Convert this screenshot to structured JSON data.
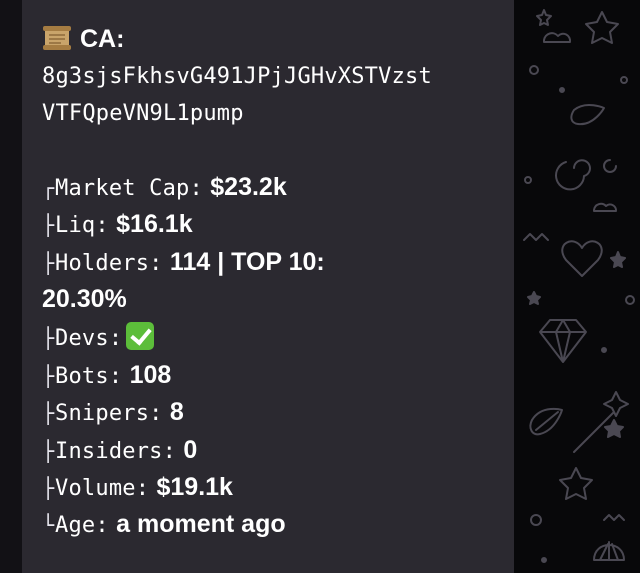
{
  "message": {
    "ca_label": "CA:",
    "ca_line1": "8g3sjsFkhsvG491JPjJGHvXSTVzst",
    "ca_line2": "VTFQpeVN9L1pump",
    "stats": [
      {
        "branch": "┌",
        "label": "Market Cap:",
        "value": "$23.2k"
      },
      {
        "branch": "├",
        "label": "Liq:",
        "value": "$16.1k"
      },
      {
        "branch": "├",
        "label": "Holders:",
        "value": "114 | TOP 10:"
      },
      {
        "branch": "",
        "label": "",
        "value": "20.30%"
      },
      {
        "branch": "├",
        "label": "Devs:",
        "value": ""
      },
      {
        "branch": "├",
        "label": "Bots:",
        "value": "108"
      },
      {
        "branch": "├",
        "label": "Snipers:",
        "value": "8"
      },
      {
        "branch": "├",
        "label": "Insiders:",
        "value": "0"
      },
      {
        "branch": "├",
        "label": "Volume:",
        "value": "$19.1k"
      },
      {
        "branch": "└",
        "label": "Age:",
        "value": "a moment ago"
      }
    ]
  },
  "icons": {
    "ca": "scroll-icon",
    "devs": "check-mark-icon"
  },
  "colors": {
    "bubble": "#2b2930",
    "check": "#5cbd3a"
  }
}
